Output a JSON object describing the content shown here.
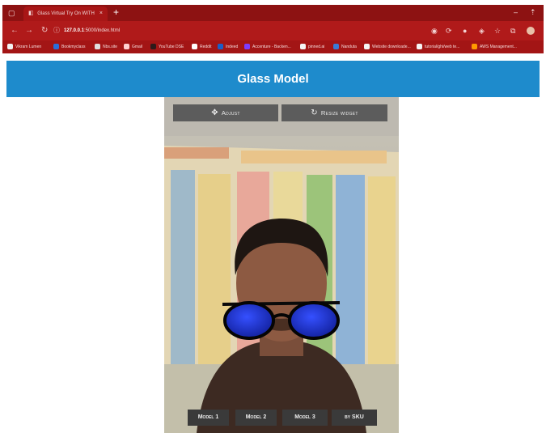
{
  "browser": {
    "tab_title": "Glass Virtual Try On WITH",
    "tab_close": "×",
    "new_tab": "+",
    "window_controls": {
      "minimize": "–",
      "maximize": "⇡"
    },
    "url": {
      "host": "127.0.0.1",
      "path": ":5000/index.html"
    },
    "bookmarks": [
      {
        "label": "Vikram Lumen",
        "color": "#f2f2f2"
      },
      {
        "label": "Bookmyclass",
        "color": "#2a6fdb"
      },
      {
        "label": "Nbs.site",
        "color": "#e0e0e0"
      },
      {
        "label": "Gmail",
        "color": "#ffd0d0"
      },
      {
        "label": "YouTube DSE",
        "color": "#2e1a1a"
      },
      {
        "label": "Reddit",
        "color": "#ffffff"
      },
      {
        "label": "Indeed",
        "color": "#1a5fc8"
      },
      {
        "label": "Accenture - Backen...",
        "color": "#7d3cff"
      },
      {
        "label": "pinned.ai",
        "color": "#f5f5f5"
      },
      {
        "label": "Nanduta",
        "color": "#3a7bd5"
      },
      {
        "label": "Website downloade...",
        "color": "#f5f5f5"
      },
      {
        "label": "tutorial/ghi/web te...",
        "color": "#f5f5f5"
      },
      {
        "label": "AWS Management...",
        "color": "#ff9900"
      }
    ]
  },
  "app": {
    "title": "Glass Model",
    "buttons": {
      "adjust": "Adjust",
      "resize": "Resize widget",
      "model1": "Model 1",
      "model2": "Model 2",
      "model3": "Model 3",
      "sku": "by SKU"
    }
  },
  "colors": {
    "header": "#1e8bcc",
    "browser_chrome": "#a81616",
    "lens": "#1a2ec8"
  }
}
